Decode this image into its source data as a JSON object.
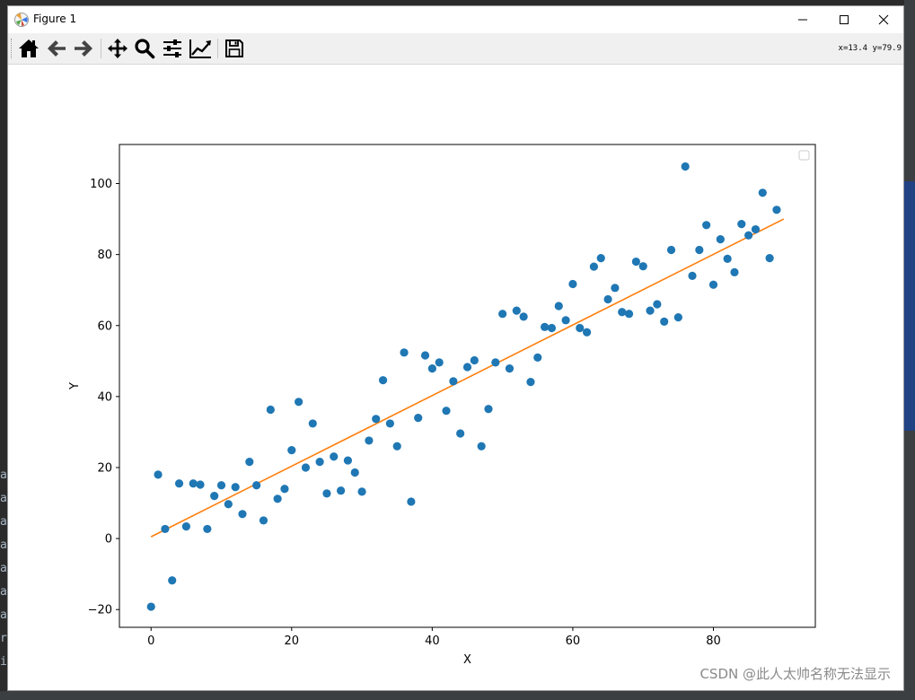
{
  "window": {
    "title": "Figure 1",
    "coord_readout": "x=13.4 y=79.9",
    "watermark": "CSDN @此人太帅名称无法显示"
  },
  "toolbar": {
    "buttons": [
      {
        "name": "home-button",
        "icon": "home-icon"
      },
      {
        "name": "back-button",
        "icon": "arrow-left-icon"
      },
      {
        "name": "forward-button",
        "icon": "arrow-right-icon"
      },
      {
        "name": "pan-button",
        "icon": "move-icon"
      },
      {
        "name": "zoom-button",
        "icon": "magnifier-icon"
      },
      {
        "name": "subplots-button",
        "icon": "sliders-icon"
      },
      {
        "name": "edit-axes-button",
        "icon": "line-chart-icon"
      },
      {
        "name": "save-button",
        "icon": "floppy-icon"
      }
    ]
  },
  "background": {
    "left_strip_chars": [
      "a",
      "a",
      "a",
      "a",
      "a",
      "a",
      "a",
      "r",
      "i"
    ]
  },
  "chart_data": {
    "type": "scatter",
    "xlabel": "X",
    "ylabel": "Y",
    "xlim": [
      -4.5,
      94.5
    ],
    "ylim": [
      -25,
      111
    ],
    "xticks": [
      0,
      20,
      40,
      60,
      80
    ],
    "yticks": [
      -20,
      0,
      20,
      40,
      60,
      80,
      100
    ],
    "legend": "top-right (empty)",
    "colors": {
      "points": "#1f77b4",
      "fit_line": "#ff7f0e"
    },
    "points": [
      [
        0,
        -19.2
      ],
      [
        1,
        18
      ],
      [
        2,
        2.7
      ],
      [
        3,
        -11.8
      ],
      [
        4,
        15.5
      ],
      [
        5,
        3.4
      ],
      [
        6,
        15.5
      ],
      [
        7,
        15.2
      ],
      [
        8,
        2.7
      ],
      [
        9,
        12
      ],
      [
        10,
        15
      ],
      [
        11,
        9.7
      ],
      [
        12,
        14.5
      ],
      [
        13,
        6.9
      ],
      [
        14,
        21.6
      ],
      [
        15,
        15
      ],
      [
        16,
        5.1
      ],
      [
        17,
        36.3
      ],
      [
        18,
        11.2
      ],
      [
        19,
        14
      ],
      [
        20,
        24.9
      ],
      [
        21,
        38.5
      ],
      [
        22,
        20
      ],
      [
        23,
        32.4
      ],
      [
        24,
        21.6
      ],
      [
        25,
        12.7
      ],
      [
        26,
        23.1
      ],
      [
        27,
        13.5
      ],
      [
        28,
        22
      ],
      [
        29,
        18.6
      ],
      [
        30,
        13.2
      ],
      [
        31,
        27.6
      ],
      [
        32,
        33.7
      ],
      [
        33,
        44.6
      ],
      [
        34,
        32.4
      ],
      [
        35,
        26
      ],
      [
        36,
        52.4
      ],
      [
        37,
        10.4
      ],
      [
        38,
        34
      ],
      [
        39,
        51.6
      ],
      [
        40,
        47.9
      ],
      [
        41,
        49.6
      ],
      [
        42,
        36
      ],
      [
        43,
        44.3
      ],
      [
        44,
        29.6
      ],
      [
        45,
        48.3
      ],
      [
        46,
        50.2
      ],
      [
        47,
        26
      ],
      [
        48,
        36.5
      ],
      [
        49,
        49.6
      ],
      [
        50,
        63.3
      ],
      [
        51,
        47.9
      ],
      [
        52,
        64.2
      ],
      [
        53,
        62.5
      ],
      [
        54,
        44.1
      ],
      [
        55,
        51
      ],
      [
        56,
        59.6
      ],
      [
        57,
        59.3
      ],
      [
        58,
        65.5
      ],
      [
        59,
        61.5
      ],
      [
        60,
        71.7
      ],
      [
        61,
        59.3
      ],
      [
        62,
        58.1
      ],
      [
        63,
        76.6
      ],
      [
        64,
        79
      ],
      [
        65,
        67.4
      ],
      [
        66,
        70.6
      ],
      [
        67,
        63.8
      ],
      [
        68,
        63.3
      ],
      [
        69,
        78
      ],
      [
        70,
        76.7
      ],
      [
        71,
        64.2
      ],
      [
        72,
        66
      ],
      [
        73,
        61.1
      ],
      [
        74,
        81.3
      ],
      [
        75,
        62.3
      ],
      [
        76,
        104.8
      ],
      [
        77,
        74
      ],
      [
        78,
        81.3
      ],
      [
        79,
        88.3
      ],
      [
        80,
        71.5
      ],
      [
        81,
        84.3
      ],
      [
        82,
        78.8
      ],
      [
        83,
        75
      ],
      [
        84,
        88.6
      ],
      [
        85,
        85.4
      ],
      [
        86,
        87.1
      ],
      [
        87,
        97.4
      ],
      [
        88,
        79
      ],
      [
        89,
        92.6
      ]
    ],
    "fit_line": {
      "x": [
        0,
        90
      ],
      "y": [
        0.5,
        90
      ]
    }
  }
}
